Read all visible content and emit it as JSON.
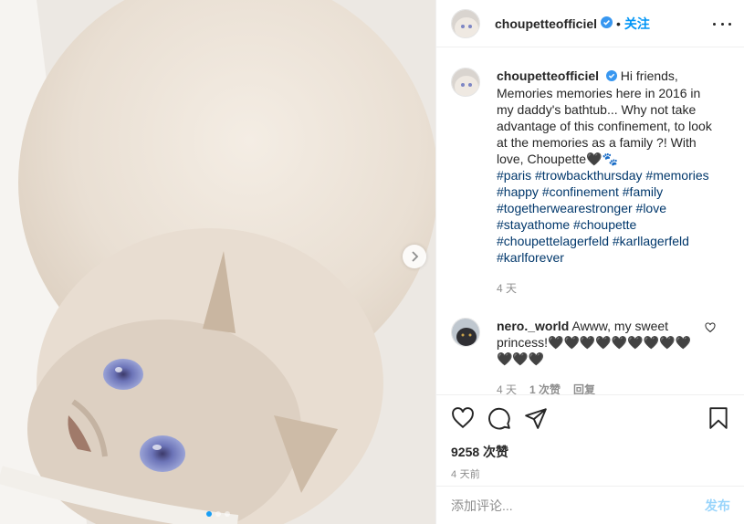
{
  "post": {
    "account": "choupetteofficiel",
    "separator": "•",
    "follow_label": "关注",
    "caption_user": "choupetteofficiel",
    "caption_body": "Hi friends, Memories memories here in 2016 in my daddy's bathtub... Why not take advantage of this confinement, to look at the memories as a family ?! With love, Choupette🖤🐾",
    "hashtags": "#paris #trowbackthursday #memories #happy #confinement #family #togetherwearestronger #love #stayathome #choupette #choupettelagerfeld #karllagerfeld #karlforever",
    "caption_age": "4 天",
    "likes": "9258 次赞",
    "posted_ago": "4 天前"
  },
  "comment": {
    "user": "nero._world",
    "text": "Awww, my sweet princess!🖤🖤🖤🖤🖤🖤🖤🖤🖤🖤🖤🖤",
    "age": "4 天",
    "likes": "1 次赞",
    "reply_label": "回复"
  },
  "composer": {
    "placeholder": "添加评论...",
    "post_label": "发布"
  },
  "carousel": {
    "slides": 3,
    "active": 1
  },
  "colors": {
    "accent": "#0095f6",
    "hashtag": "#00376b",
    "muted": "#8e8e8e"
  },
  "icons": [
    "chevron-right-icon",
    "verified-badge-icon",
    "more-options-icon",
    "heart-icon",
    "comment-icon",
    "share-icon",
    "bookmark-icon"
  ]
}
